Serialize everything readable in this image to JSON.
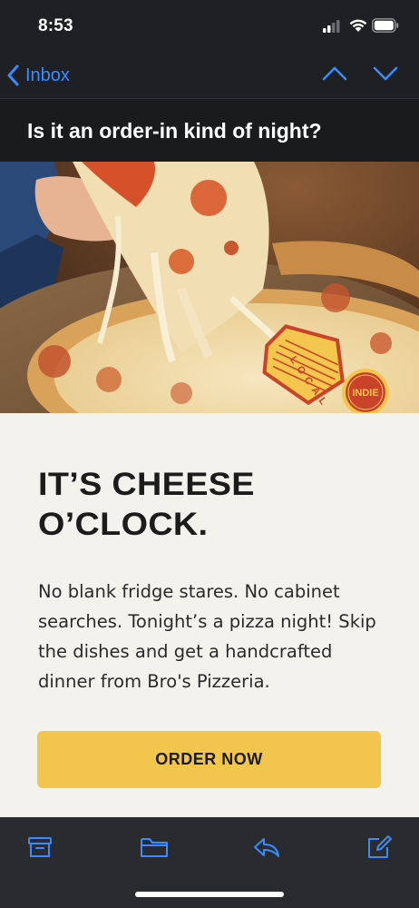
{
  "status_bar": {
    "time": "8:53"
  },
  "nav": {
    "back_label": "Inbox"
  },
  "email": {
    "subject": "Is it an order-in kind of night?"
  },
  "hero": {
    "badge_local": "LOCAL",
    "badge_indie": "INDIE"
  },
  "content": {
    "headline": "IT’S CHEESE\nO’CLOCK.",
    "paragraph": "No blank fridge stares. No cabinet\nsearches. Tonight’s a pizza night! Skip\nthe dishes and get a handcrafted\ndinner from Bro's Pizzeria.",
    "cta_label": "ORDER NOW"
  },
  "colors": {
    "accent": "#3a8bff",
    "cta": "#f2c54d",
    "badge_red": "#c8432a",
    "badge_yellow": "#f3c64e"
  },
  "toolbar": {
    "icons": [
      "archive-icon",
      "folder-icon",
      "reply-icon",
      "compose-icon"
    ]
  }
}
